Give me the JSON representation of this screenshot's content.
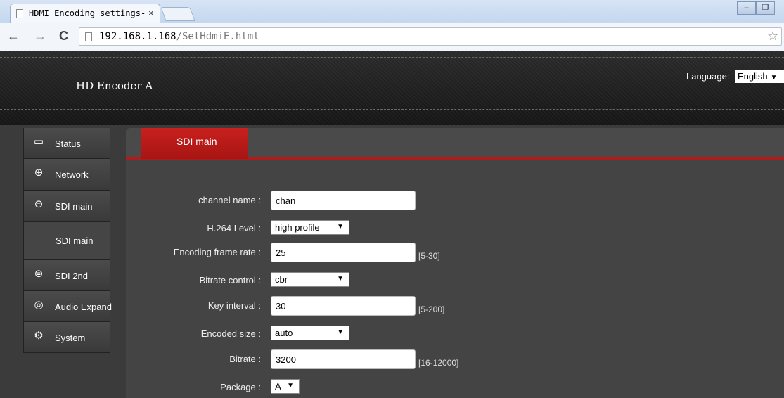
{
  "browser": {
    "tab_title": "HDMI Encoding settings-",
    "tab_close": "×",
    "url_host": "192.168.1.168",
    "url_path": "/SetHdmiE.html",
    "window_min": "–",
    "window_restore": "❐",
    "back": "←",
    "forward": "→",
    "reload": "C",
    "star": "☆"
  },
  "header": {
    "title": "HD Encoder A",
    "language_label": "Language:",
    "language_value": "English"
  },
  "sidebar": {
    "items": [
      {
        "label": "Status",
        "icon": "monitor-icon",
        "glyph": "▭"
      },
      {
        "label": "Network",
        "icon": "globe-icon",
        "glyph": "⊕"
      },
      {
        "label": "SDI main",
        "icon": "disk-icon",
        "glyph": "⊜"
      },
      {
        "label": "SDI main",
        "icon": "",
        "glyph": ""
      },
      {
        "label": "SDI 2nd",
        "icon": "disk-icon",
        "glyph": "⊜"
      },
      {
        "label": "Audio Expand",
        "icon": "audio-icon",
        "glyph": "◎"
      },
      {
        "label": "System",
        "icon": "gear-icon",
        "glyph": "⚙"
      }
    ]
  },
  "panel": {
    "tab_label": "SDI main",
    "fields": {
      "channel_name": {
        "label": "channel name :",
        "value": "chan"
      },
      "h264_level": {
        "label": "H.264 Level :",
        "value": "high profile"
      },
      "frame_rate": {
        "label": "Encoding frame rate :",
        "value": "25",
        "hint": "[5-30]"
      },
      "bitrate_control": {
        "label": "Bitrate control :",
        "value": "cbr"
      },
      "key_interval": {
        "label": "Key interval :",
        "value": "30",
        "hint": "[5-200]"
      },
      "encoded_size": {
        "label": "Encoded size :",
        "value": "auto"
      },
      "bitrate": {
        "label": "Bitrate :",
        "value": "3200",
        "hint": "[16-12000]"
      },
      "package": {
        "label": "Package :",
        "value": "A"
      }
    }
  },
  "colors": {
    "accent_red": "#b51a1a",
    "header_bg": "#1c1c1c",
    "sidebar_bg": "#444444"
  }
}
